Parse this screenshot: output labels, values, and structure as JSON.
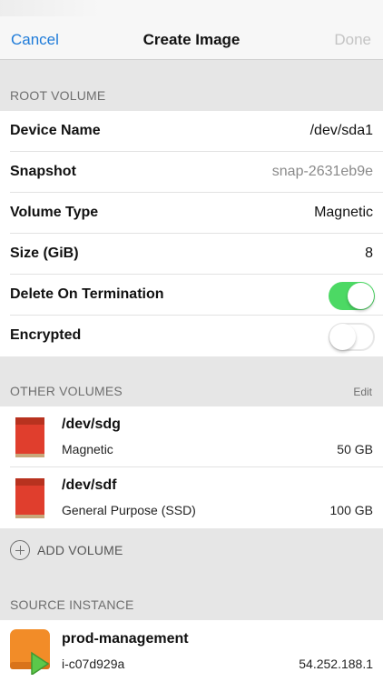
{
  "nav": {
    "cancel": "Cancel",
    "title": "Create Image",
    "done": "Done"
  },
  "root_volume": {
    "header": "ROOT VOLUME",
    "rows": [
      {
        "key": "Device Name",
        "value": "/dev/sda1"
      },
      {
        "key": "Snapshot",
        "value": "snap-2631eb9e"
      },
      {
        "key": "Volume Type",
        "value": "Magnetic"
      },
      {
        "key": "Size (GiB)",
        "value": "8"
      },
      {
        "key": "Delete On Termination",
        "toggle": true
      },
      {
        "key": "Encrypted",
        "toggle": false
      }
    ]
  },
  "other_volumes": {
    "header": "OTHER VOLUMES",
    "edit": "Edit",
    "items": [
      {
        "name": "/dev/sdg",
        "type": "Magnetic",
        "size": "50 GB",
        "icon": "drive-icon"
      },
      {
        "name": "/dev/sdf",
        "type": "General Purpose (SSD)",
        "size": "100 GB",
        "icon": "drive-icon"
      }
    ],
    "add_label": "ADD VOLUME"
  },
  "source_instance": {
    "header": "SOURCE INSTANCE",
    "name": "prod-management",
    "id": "i-c07d929a",
    "ip": "54.252.188.1",
    "icon": "instance-running-icon"
  },
  "colors": {
    "accent": "#1e7bd9",
    "toggle_on": "#4cd964",
    "drive": "#e03e2d",
    "instance": "#f28c28",
    "running": "#5cc84a"
  }
}
